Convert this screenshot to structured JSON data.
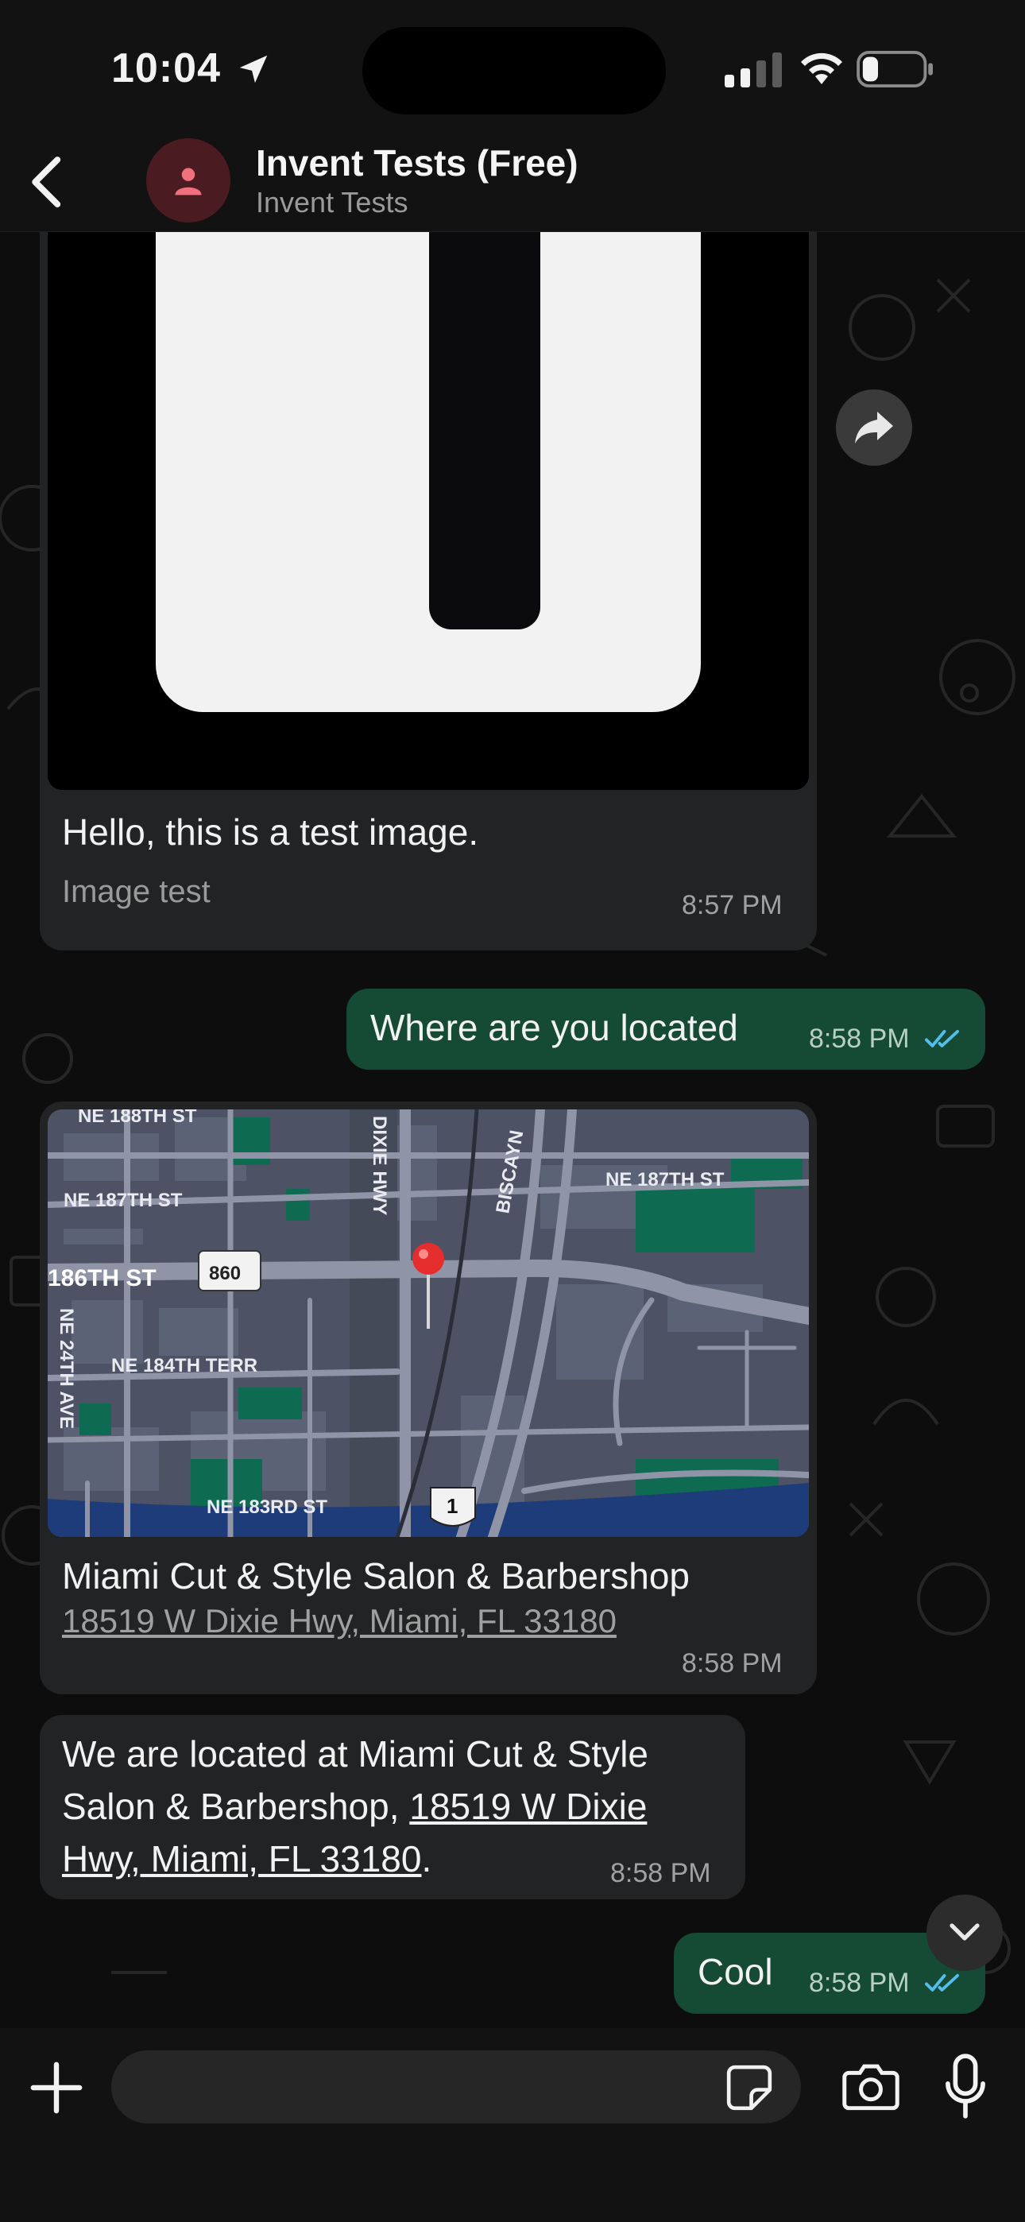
{
  "status_bar": {
    "time": "10:04"
  },
  "header": {
    "title": "Invent Tests (Free)",
    "subtitle": "Invent Tests"
  },
  "messages": {
    "image_message": {
      "caption": "Hello, this is a test image.",
      "footer": "Image test",
      "time": "8:57 PM"
    },
    "outgoing_1": {
      "text": "Where are you located",
      "time": "8:58 PM"
    },
    "location": {
      "name": "Miami Cut & Style Salon & Barbershop",
      "address": "18519 W Dixie Hwy, Miami, FL 33180",
      "time": "8:58 PM",
      "map_labels": {
        "ne188": "NE 188TH ST",
        "ne187_left": "NE 187TH ST",
        "ne187_right": "NE 187TH ST",
        "st186": "186TH ST",
        "shield860": "860",
        "dixie": "DIXIE HWY",
        "biscayne": "BISCAYN",
        "terr184": "NE 184TH TERR",
        "ave24": "NE 24TH AVE",
        "ne183": "NE 183RD ST",
        "shield1": "1"
      }
    },
    "incoming_text": {
      "line1": "We are located at Miami Cut & Style",
      "line2_plain": "Salon & Barbershop, ",
      "line2_link": "18519 W Dixie",
      "line3_link": "Hwy, Miami, FL 33180",
      "line3_end": ".",
      "time": "8:58 PM"
    },
    "outgoing_2": {
      "text": "Cool",
      "time": "8:58 PM"
    }
  },
  "input": {
    "placeholder": ""
  },
  "colors": {
    "outgoing_bubble": "#154a35",
    "incoming_bubble": "#222324",
    "read_ticks": "#53bdeb",
    "avatar_bg": "#4a1c22"
  },
  "icons": [
    "location-arrow-icon",
    "signal-icon",
    "wifi-icon",
    "battery-icon",
    "back-chevron-icon",
    "person-icon",
    "forward-icon",
    "double-check-icon",
    "chevron-down-icon",
    "plus-icon",
    "sticker-icon",
    "camera-icon",
    "microphone-icon",
    "map-pin-icon"
  ]
}
